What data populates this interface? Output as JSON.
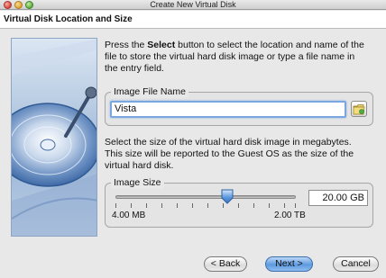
{
  "window": {
    "title": "Create New Virtual Disk"
  },
  "header": {
    "title": "Virtual Disk Location and Size"
  },
  "intro": {
    "line1_pre": "Press the ",
    "line1_bold": "Select",
    "line1_post": " button to select the location and name of the",
    "line2": "file to store the virtual hard disk image or type a file name in",
    "line3": "the entry field."
  },
  "image_file": {
    "group_title": "Image File Name",
    "value": "Vista",
    "select_icon": "folder-select-icon"
  },
  "size_help": {
    "line1": "Select the size of the virtual hard disk image in megabytes.",
    "line2": "This size will be reported to the Guest OS as the size of the",
    "line3": "virtual hard disk."
  },
  "image_size": {
    "group_title": "Image Size",
    "value": "20.00 GB",
    "min_label": "4.00 MB",
    "max_label": "2.00 TB",
    "slider_fraction": 0.62
  },
  "buttons": {
    "back": "< Back",
    "next": "Next >",
    "cancel": "Cancel"
  },
  "colors": {
    "accent": "#5d9ae0",
    "focus": "#7ba7e1"
  }
}
